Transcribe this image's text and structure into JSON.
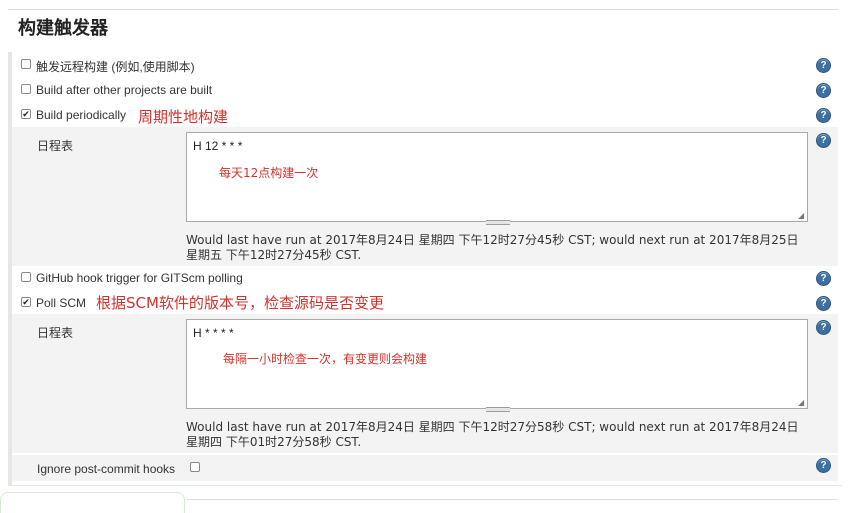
{
  "section": {
    "title": "构建触发器"
  },
  "triggers": {
    "remote": {
      "label": "触发远程构建 (例如,使用脚本)",
      "checked": false
    },
    "after_other": {
      "label": "Build after other projects are built",
      "checked": false
    },
    "periodically": {
      "label": "Build periodically",
      "checked": true,
      "annotation": "周期性地构建",
      "schedule_label": "日程表",
      "schedule_value": "H 12 * * *",
      "schedule_note": "每天12点构建一次",
      "run_info": "Would last have run at 2017年8月24日 星期四 下午12时27分45秒 CST; would next run at 2017年8月25日 星期五 下午12时27分45秒 CST."
    },
    "github_hook": {
      "label": "GitHub hook trigger for GITScm polling",
      "checked": false
    },
    "poll_scm": {
      "label": "Poll SCM",
      "checked": true,
      "annotation": "根据SCM软件的版本号，检查源码是否变更",
      "schedule_label": "日程表",
      "schedule_value": "H * * * *",
      "schedule_note": "每隔一小时检查一次，有变更则会构建",
      "run_info": "Would last have run at 2017年8月24日 星期四 下午12时27分58秒 CST; would next run at 2017年8月24日 星期四 下午01时27分58秒 CST."
    },
    "ignore_post_commit": {
      "label": "Ignore post-commit hooks",
      "checked": false
    }
  },
  "icons": {
    "help": "help-icon",
    "checkmark": "✔"
  },
  "colors": {
    "annotation": "#d3322b",
    "help_icon": "#3d6f9f",
    "panel_bg": "#f3f3f3"
  }
}
